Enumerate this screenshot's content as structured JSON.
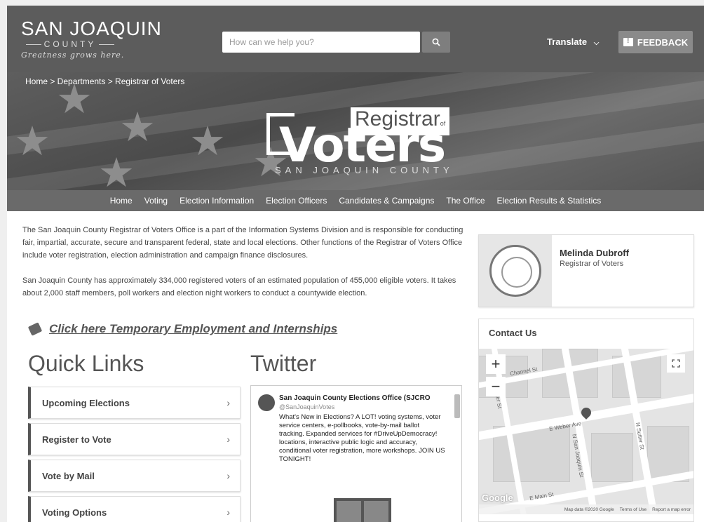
{
  "header": {
    "logo_top": "SAN JOAQUIN",
    "logo_mid": "COUNTY",
    "logo_tagline": "Greatness grows here.",
    "search_placeholder": "How can we help you?",
    "translate_label": "Translate",
    "feedback_label": "FEEDBACK"
  },
  "breadcrumb": "Home > Departments > Registrar of Voters",
  "hero": {
    "registrar": "Registrar",
    "of": "of",
    "voters": "Voters",
    "county": "SAN JOAQUIN COUNTY"
  },
  "nav": [
    "Home",
    "Voting",
    "Election Information",
    "Election Officers",
    "Candidates & Campaigns",
    "The Office",
    "Election Results & Statistics"
  ],
  "intro": {
    "p1": "The San Joaquin County Registrar of Voters Office is a part of the Information Systems Division and is responsible for conducting fair, impartial, accurate, secure and transparent federal, state and local elections. Other functions of the Registrar of Voters Office include voter registration, election administration and campaign finance disclosures.",
    "p2": "San Joaquin County has approximately 334,000 registered voters of an estimated population of 455,000 eligible voters. It takes about 2,000 staff members, poll workers and election night workers to conduct a countywide election."
  },
  "employment_link": "Click here Temporary Employment and Internships",
  "quick_links": {
    "heading": "Quick Links",
    "items": [
      "Upcoming Elections",
      "Register to Vote",
      "Vote by Mail",
      "Voting Options"
    ]
  },
  "twitter": {
    "heading": "Twitter",
    "name": "San Joaquin County Elections Office (SJCRÖ",
    "handle": "@SanJoaquinVotes",
    "text": "What's New in Elections? A LOT! voting systems, voter service centers, e-pollbooks, vote-by-mail ballot tracking. Expanded services for #DriveUpDemocracy! locations, interactive public logic and accuracy, conditional voter registration, more workshops. JOIN US TONIGHT!"
  },
  "profile": {
    "name": "Melinda Dubroff",
    "title": "Registrar of Voters"
  },
  "contact": {
    "heading": "Contact Us",
    "map_labels": {
      "channel": "Channel St",
      "weber": "E Weber Ave",
      "main": "E Main St",
      "hunter": "Hunter St",
      "sanjoaquin": "N San Joaquin St",
      "sutter": "N Sutter St"
    },
    "map_footer": [
      "Map data ©2020 Google",
      "Terms of Use",
      "Report a map error"
    ],
    "google": "Google"
  }
}
